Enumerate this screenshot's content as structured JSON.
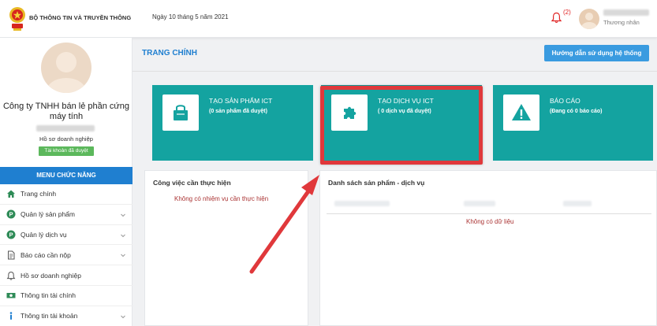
{
  "header": {
    "ministry": "BỘ THÔNG TIN VÀ TRUYỀN THÔNG",
    "date": "Ngày 10 tháng 5 năm 2021",
    "notif_count": "(2)",
    "user_role": "Thương nhân"
  },
  "sidebar": {
    "company": "Công ty TNHH bán lẻ phần cứng máy tính",
    "profile_label": "Hồ sơ doanh nghiệp",
    "approved_badge": "Tài khoản đã duyệt",
    "menu_title": "MENU CHỨC NĂNG",
    "items": [
      {
        "label": "Trang chính",
        "icon": "home-icon"
      },
      {
        "label": "Quản lý sản phẩm",
        "icon": "p-circle-icon"
      },
      {
        "label": "Quản lý dịch vụ",
        "icon": "p-circle-icon"
      },
      {
        "label": "Báo cáo cần nộp",
        "icon": "document-icon"
      },
      {
        "label": "Hồ sơ doanh nghiệp",
        "icon": "bell-icon"
      },
      {
        "label": "Thông tin tài chính",
        "icon": "money-icon"
      },
      {
        "label": "Thông tin tài khoản",
        "icon": "info-icon"
      }
    ]
  },
  "main": {
    "title": "TRANG CHÍNH",
    "guide_button": "Hướng dẫn sử dụng hệ thống",
    "cards": [
      {
        "title": "TẠO SẢN PHẨM ICT",
        "subtitle": "(0 sản phẩm đã duyệt)",
        "icon": "shopping-bag-icon"
      },
      {
        "title": "TẠO DỊCH VỤ ICT",
        "subtitle": "( 0 dịch vụ đã duyệt)",
        "icon": "puzzle-icon"
      },
      {
        "title": "BÁO CÁO",
        "subtitle": "(Đang có 0 báo cáo)",
        "icon": "warning-icon"
      }
    ],
    "tasks_panel": {
      "title": "Công việc cần thực hiện",
      "empty": "Không có nhiệm vụ cần thực hiện"
    },
    "list_panel": {
      "title": "Danh sách sản phẩm - dịch vụ",
      "empty": "Không có dữ liệu"
    }
  },
  "colors": {
    "primary": "#1f7fd0",
    "card": "#14a3a0",
    "highlight": "#e0383b",
    "success": "#5cb85c"
  }
}
